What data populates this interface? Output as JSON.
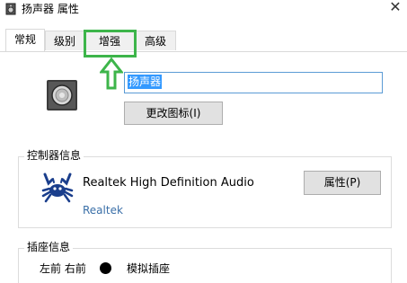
{
  "window": {
    "title": "扬声器 属性",
    "close_glyph": "✕"
  },
  "tabs": [
    {
      "label": "常规",
      "active": true
    },
    {
      "label": "级别",
      "active": false
    },
    {
      "label": "增强",
      "active": false,
      "highlighted": true
    },
    {
      "label": "高级",
      "active": false
    }
  ],
  "annotation": {
    "highlight_color": "#3db54a"
  },
  "device": {
    "name_value": "扬声器",
    "change_icon_label": "更改图标(I)"
  },
  "controller": {
    "group_title": "控制器信息",
    "device_name": "Realtek High Definition Audio",
    "vendor": "Realtek",
    "properties_label": "属性(P)"
  },
  "jack": {
    "group_title": "插座信息",
    "position": "左前 右前",
    "type": "模拟插座",
    "dot_color": "#000000"
  },
  "colors": {
    "selection": "#3399ff",
    "link": "#3a6fa8",
    "input_border": "#5b9bd5"
  }
}
